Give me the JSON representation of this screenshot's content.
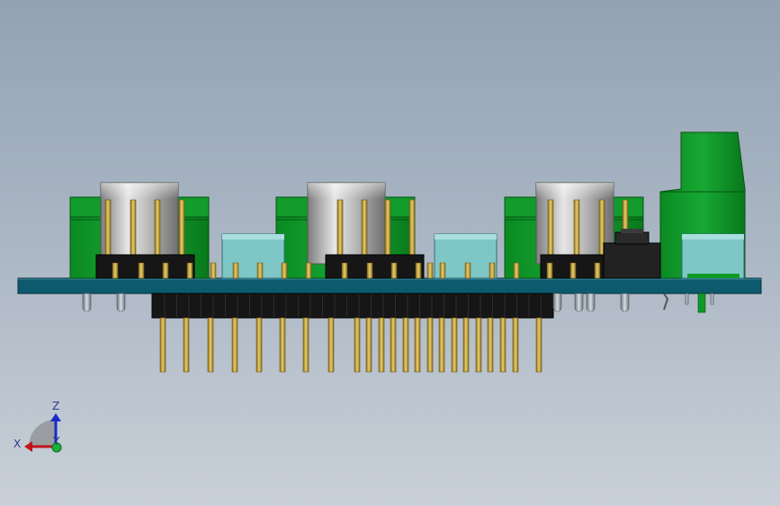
{
  "view": {
    "type": "CAD model viewport",
    "orientation": "front"
  },
  "triad": {
    "x_label": "X",
    "y_label": "Y",
    "z_label": "Z",
    "x_color": "#c0141c",
    "y_color": "#19b03a",
    "z_color": "#1b2bc9"
  },
  "colors": {
    "pcb": "#0d5a6e",
    "pcb_edge": "#063847",
    "terminal_green": "#0e9a28",
    "terminal_dark": "#067014",
    "pin_gold": "#c9a43a",
    "header_black": "#151515",
    "metal": "#b9b9b9",
    "connector_teal": "#7fc7c7",
    "lead_gray": "#9aa4ae"
  },
  "parts": [
    {
      "name": "screw-terminal",
      "count": 4
    },
    {
      "name": "metal-can-component",
      "count": 3
    },
    {
      "name": "teal-connector",
      "count": 3
    },
    {
      "name": "pin-header",
      "count": 1
    },
    {
      "name": "tactile-switch",
      "count": 1
    }
  ]
}
